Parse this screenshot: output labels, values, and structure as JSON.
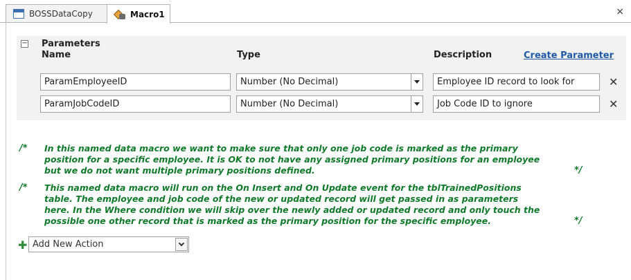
{
  "tabs": [
    {
      "label": "BOSSDataCopy",
      "icon": "table-icon"
    },
    {
      "label": "Macro1",
      "icon": "macro-icon"
    }
  ],
  "close_glyph": "×",
  "parameters": {
    "title": "Parameters",
    "collapse_glyph": "⊟",
    "columns": {
      "name": "Name",
      "type": "Type",
      "description": "Description"
    },
    "create_link": "Create Parameter",
    "rows": [
      {
        "name": "ParamEmployeeID",
        "type": "Number (No Decimal)",
        "description": "Employee ID record to look for"
      },
      {
        "name": "ParamJobCodeID",
        "type": "Number (No Decimal)",
        "description": "Job Code ID to ignore"
      }
    ],
    "delete_glyph": "✕"
  },
  "comments": [
    {
      "open": "/*",
      "lines": [
        "In this named data macro we want to make sure that only one job code is marked as the primary",
        "position for a specific employee. It is OK to not have any assigned primary positions for an employee",
        "but we do not want multiple primary positions defined."
      ],
      "close": "*/"
    },
    {
      "open": "/*",
      "lines": [
        "This named data macro will run on the On Insert and On Update event for the tblTrainedPositions",
        "table. The employee and job code of the new or updated record will get passed in as parameters",
        "here. In the Where condition we will skip over the newly added or updated record and only touch the",
        "possible one other record that is marked as the primary position for the specific employee."
      ],
      "close": "*/"
    }
  ],
  "add_action": {
    "plus_glyph": "✚",
    "label": "Add New Action"
  },
  "colors": {
    "comment": "#0f7a2a",
    "link": "#1f5aa6",
    "panel": "#f2f2f2"
  }
}
